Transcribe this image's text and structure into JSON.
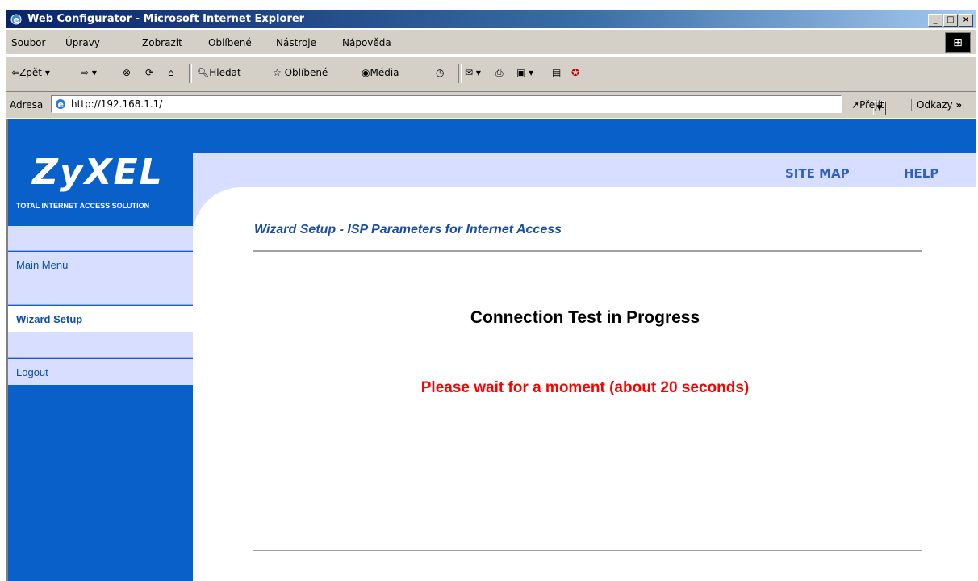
{
  "browser": {
    "window_title": "Web Configurator - Microsoft Internet Explorer",
    "menu": [
      "Soubor",
      "Úpravy",
      "Zobrazit",
      "Oblíbené",
      "Nástroje",
      "Nápověda"
    ],
    "toolbar": {
      "back": "Zpět",
      "search": "Hledat",
      "favorites": "Oblíbené",
      "media": "Média"
    },
    "address_label": "Adresa",
    "address_url": "http://192.168.1.1/",
    "go_label": "Přejít",
    "links_label": "Odkazy"
  },
  "page": {
    "logo": "ZyXEL",
    "logo_tagline": "TOTAL INTERNET ACCESS SOLUTION",
    "top_links": {
      "site_map": "SITE MAP",
      "help": "HELP"
    },
    "nav": {
      "main_menu": "Main Menu",
      "wizard_setup": "Wizard Setup",
      "logout": "Logout"
    },
    "heading": "Wizard Setup - ISP Parameters for Internet Access",
    "status_title": "Connection Test in Progress",
    "status_message": "Please wait for a moment (about 20 seconds)"
  },
  "colors": {
    "brand_blue": "#0860c8",
    "light_band": "#d8deff",
    "warning": "#ff0000"
  }
}
